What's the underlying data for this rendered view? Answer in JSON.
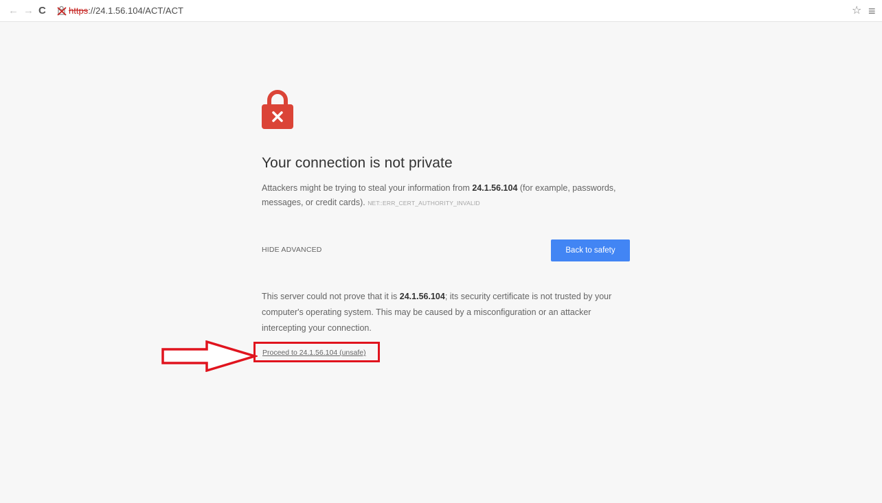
{
  "browser": {
    "nav": {
      "back_icon": "arrow-left-icon",
      "forward_icon": "arrow-right-icon",
      "reload_icon": "reload-icon"
    },
    "url": {
      "scheme": "https",
      "rest": "://24.1.56.104/ACT/ACT",
      "security_icon": "broken-lock-icon"
    },
    "star_icon": "star-icon",
    "menu_icon": "menu-icon"
  },
  "page": {
    "lock_icon": "red-lock-x-icon",
    "title": "Your connection is not private",
    "intro_before": "Attackers might be trying to steal your information from ",
    "host": "24.1.56.104",
    "intro_after": " (for example, passwords, messages, or credit cards). ",
    "error_code": "NET::ERR_CERT_AUTHORITY_INVALID",
    "hide_advanced": "HIDE ADVANCED",
    "back_to_safety": "Back to safety",
    "details_before": "This server could not prove that it is ",
    "details_host": "24.1.56.104",
    "details_after": "; its security certificate is not trusted by your computer's operating system. This may be caused by a misconfiguration or an attacker intercepting your connection.",
    "proceed_link": "Proceed to 24.1.56.104 (unsafe)"
  },
  "annotation": {
    "arrow_icon": "red-arrow-icon",
    "box_color": "#e0141e"
  },
  "colors": {
    "button_blue": "#4285f4",
    "lock_red": "#db4437",
    "page_bg": "#f7f7f7"
  }
}
